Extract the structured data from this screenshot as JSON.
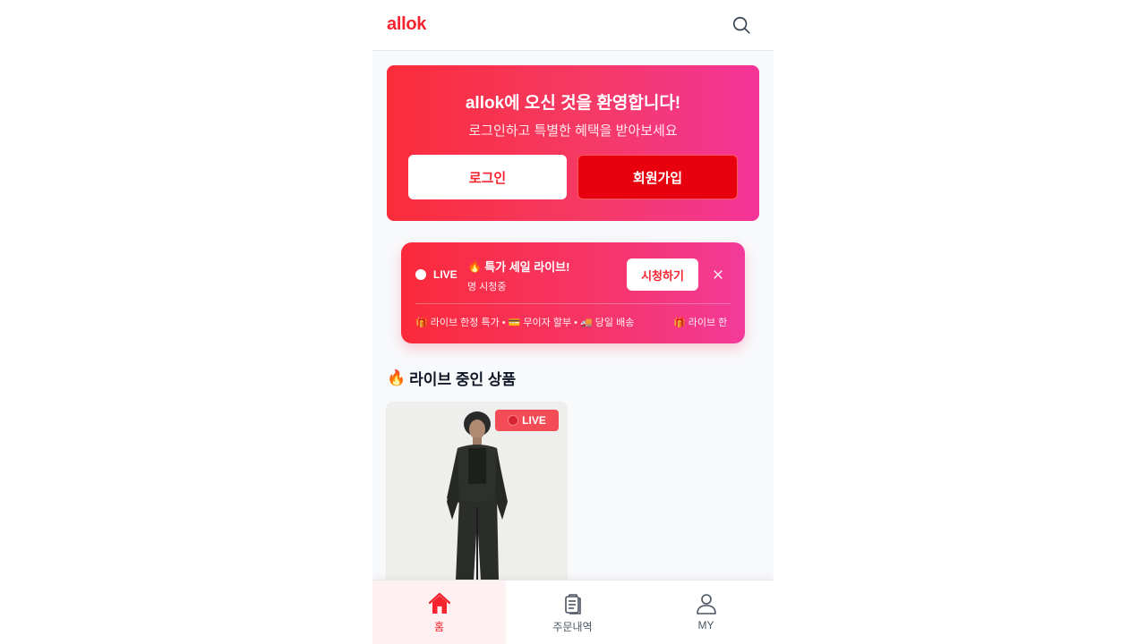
{
  "header": {
    "logo": "allok",
    "search_icon": "search-icon"
  },
  "welcome": {
    "title": "allok에 오신 것을 환영합니다!",
    "subtitle": "로그인하고 특별한 혜택을 받아보세요",
    "login_label": "로그인",
    "signup_label": "회원가입"
  },
  "live_banner": {
    "status": "LIVE",
    "title_emoji": "🔥",
    "title": "특가 세일 라이브!",
    "viewers": "명 시청중",
    "watch_label": "시청하기",
    "ticker_text": "🎁 라이브 한정 특가 • 💳 무이자 할부 • 🚚 당일 배송",
    "ticker_text_repeat": "🎁 라이브 한"
  },
  "section": {
    "emoji": "🔥",
    "title": "라이브 중인 상품"
  },
  "product": {
    "badge": "LIVE"
  },
  "bottom_nav": {
    "items": [
      {
        "label": "홈",
        "icon": "home-icon",
        "active": true
      },
      {
        "label": "주문내역",
        "icon": "clipboard-icon",
        "active": false
      },
      {
        "label": "MY",
        "icon": "user-icon",
        "active": false
      }
    ]
  },
  "colors": {
    "brand": "#f5242f",
    "signup_bg": "#e8000e",
    "gradient_end": "#f5349a"
  }
}
